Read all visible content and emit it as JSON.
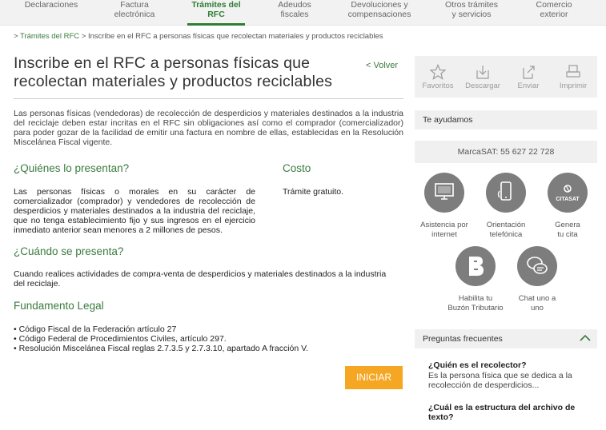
{
  "nav": [
    {
      "label": "Declaraciones"
    },
    {
      "label": "Factura\nelectrónica"
    },
    {
      "label": "Trámites del\nRFC"
    },
    {
      "label": "Adeudos\nfiscales"
    },
    {
      "label": "Devoluciones y\ncompensaciones"
    },
    {
      "label": "Otros trámites\ny servicios"
    },
    {
      "label": "Comercio\nexterior"
    }
  ],
  "breadcrumb": {
    "parent": "Trámites del RFC",
    "current": "Inscribe en el RFC a personas físicas que recolectan materiales y productos reciclables",
    "sep": ">"
  },
  "page": {
    "title": "Inscribe en el RFC a personas físicas que recolectan materiales y productos reciclables",
    "back": "< Volver",
    "intro": "Las personas físicas (vendedoras) de recolección de desperdicios y materiales destinados a la industria del reciclaje deben estar incritas en el RFC sin obligaciones así como el comprador (comercializador) para poder gozar de la facilidad de emitir una factura en nombre de ellas, establecidas en la Resolución Miscelánea Fiscal vigente.",
    "quienes_title": "¿Quiénes lo presentan?",
    "quienes_text": "Las personas físicas o morales en su carácter de comercializador (comprador) y vendedores de recolección de desperdicios y materiales destinados a la industria del reciclaje, que no tenga establecimiento fijo y sus ingresos en el ejercicio inmediato anterior sean menores a 2 millones de pesos.",
    "costo_title": "Costo",
    "costo_text": "Trámite gratuito.",
    "cuando_title": "¿Cuándo se presenta?",
    "cuando_text": "Cuando realices actividades de compra-venta de desperdicios y materiales destinados a la industria del reciclaje.",
    "fundamento_title": "Fundamento Legal",
    "fundamento": [
      "• Código Fiscal de la Federación artículo 27",
      "• Código Federal de Procedimientos Civiles, artículo 297.",
      "• Resolución Miscelánea Fiscal reglas 2.7.3.5 y 2.7.3.10, apartado A fracción V."
    ],
    "iniciar": "INICIAR"
  },
  "share": [
    {
      "label": "Favoritos",
      "icon": "star-icon"
    },
    {
      "label": "Descargar",
      "icon": "download-icon"
    },
    {
      "label": "Enviar",
      "icon": "send-icon"
    },
    {
      "label": "Imprimir",
      "icon": "print-icon"
    }
  ],
  "help": {
    "header": "Te ayudamos",
    "marca": "MarcaSAT: 55 627 22 728",
    "items": [
      {
        "label": "Asistencia por\ninternet",
        "icon": "computer-icon"
      },
      {
        "label": "Orientación\ntelefónica",
        "icon": "phone-icon"
      },
      {
        "label": "Genera\ntu cita",
        "icon": "citasat-icon",
        "badge": "CITASAT"
      },
      {
        "label": "Habilita tu\nBuzón Tributario",
        "icon": "buzon-icon"
      },
      {
        "label": "Chat uno a\nuno",
        "icon": "chat-icon"
      }
    ]
  },
  "faq": {
    "header": "Preguntas frecuentes",
    "items": [
      {
        "q": "¿Quién es el recolector?",
        "a": "Es la persona física que se dedica a la recolección de desperdicios..."
      },
      {
        "q": "¿Cuál es la estructura del archivo de texto?"
      }
    ]
  },
  "colors": {
    "accent": "#3a7b3e",
    "button": "#f5a623",
    "icon_circle": "#7d7d7d"
  }
}
